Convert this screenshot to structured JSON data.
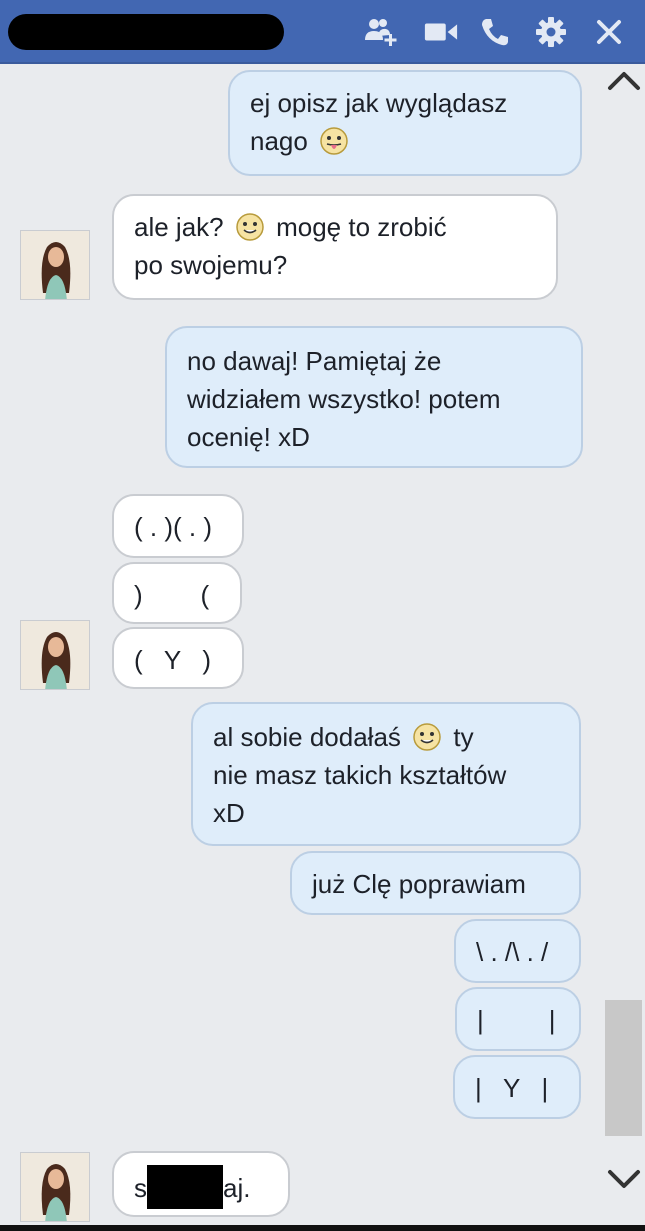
{
  "header": {
    "contact_name_redacted": true,
    "icons": [
      "add-friend-icon",
      "video-call-icon",
      "phone-call-icon",
      "gear-icon",
      "close-icon"
    ]
  },
  "messages": {
    "m1": {
      "line1": "ej opisz jak wyglądasz",
      "line2": "nago"
    },
    "m2": {
      "line1a": "ale jak?",
      "line1b": "mogę to zrobić",
      "line2": "po swojemu?"
    },
    "m3": {
      "line1": "no dawaj! Pamiętaj że",
      "line2": "widziałem wszystko! potem",
      "line3": "ocenię! xD"
    },
    "m4": "( . )( . )",
    "m5": ")        (",
    "m6": "(   Y   )",
    "m7": {
      "line1a": "al sobie dodałaś",
      "line1b": "ty",
      "line2": "nie masz takich kształtów",
      "line3": "xD"
    },
    "m8": "już Clę poprawiam",
    "m9": "\\ . /\\ . /",
    "m10": "|         |",
    "m11": "|   Y   |",
    "m12": {
      "prefix": "s",
      "suffix": "aj."
    }
  },
  "emoji": {
    "tongue": "tongue-out-emoji",
    "smile": "smile-emoji"
  },
  "colors": {
    "header": "#4267b2",
    "background": "#e9ebee",
    "outgoing": "#dfedfa",
    "incoming": "#ffffff"
  }
}
